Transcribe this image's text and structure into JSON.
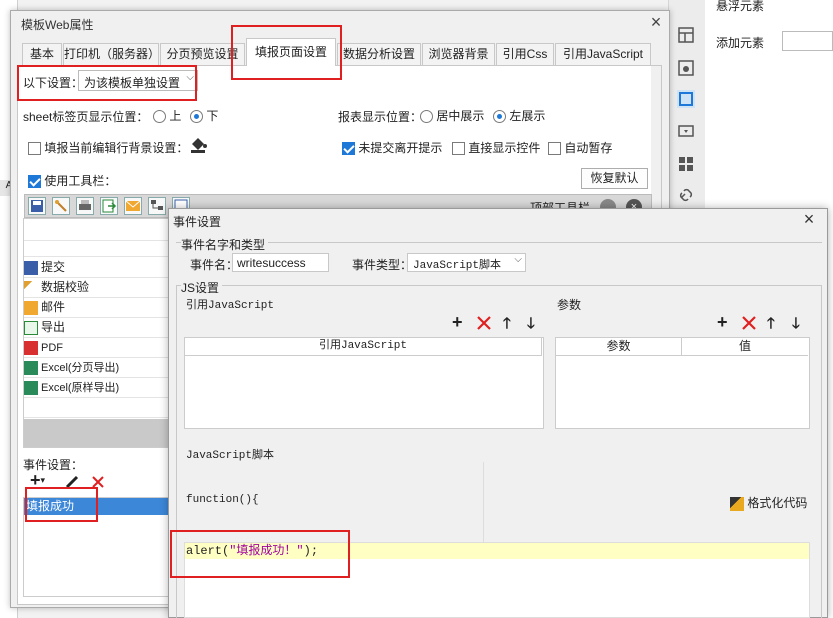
{
  "bg": {
    "right_panel": {
      "floating_label": "悬浮元素",
      "add_label": "添加元素"
    },
    "left_col_label": "A"
  },
  "web_dialog": {
    "title": "模板Web属性",
    "tabs": [
      "基本",
      "打印机（服务器）",
      "分页预览设置",
      "填报页面设置",
      "数据分析设置",
      "浏览器背景",
      "引用Css",
      "引用JavaScript"
    ],
    "active_tab": 3,
    "setting_label": "以下设置：",
    "setting_value": "为该模板单独设置",
    "sheet_pos_label": "sheet标签页显示位置：",
    "sheet_up": "上",
    "sheet_down": "下",
    "report_pos_label": "报表显示位置：",
    "report_center": "居中展示",
    "report_left": "左展示",
    "row_bg_label": "填报当前编辑行背景设置：",
    "unsubmit_label": "未提交离开提示",
    "direct_show_label": "直接显示控件",
    "auto_save_label": "自动暂存",
    "use_toolbar_label": "使用工具栏：",
    "restore_label": "恢复默认",
    "top_toolbar_label": "顶部工具栏",
    "toolbar_items": [
      {
        "label": "提交",
        "icon": "save-icon"
      },
      {
        "label": "数据校验",
        "icon": "verify-icon"
      },
      {
        "label": "邮件",
        "icon": "mail-icon"
      },
      {
        "label": "导出",
        "icon": "export-icon"
      },
      {
        "label": "PDF",
        "icon": "pdf-icon"
      },
      {
        "label": "Excel(分页导出)",
        "icon": "excel-icon"
      },
      {
        "label": "Excel(原样导出)",
        "icon": "excel-icon"
      }
    ],
    "event_label": "事件设置：",
    "event_item": "填报成功"
  },
  "event_dialog": {
    "title": "事件设置",
    "group_name_type": "事件名字和类型",
    "event_name_label": "事件名：",
    "event_name_value": "writesuccess",
    "event_type_label": "事件类型：",
    "event_type_value": "JavaScript脚本",
    "js_group": "JS设置",
    "ref_js_label": "引用JavaScript",
    "params_label": "参数",
    "ref_js_col": "引用JavaScript",
    "param_col": "参数",
    "value_col": "值",
    "script_label": "JavaScript脚本",
    "func_sig": "function(){",
    "format_label": "格式化代码",
    "code_prefix": "alert(",
    "code_string": "\"填报成功！\"",
    "code_suffix": ");"
  },
  "colors": {
    "accent": "#1e78d7",
    "highlight": "#e02020",
    "code_line": "#ffffc4",
    "string": "#a000a0"
  }
}
